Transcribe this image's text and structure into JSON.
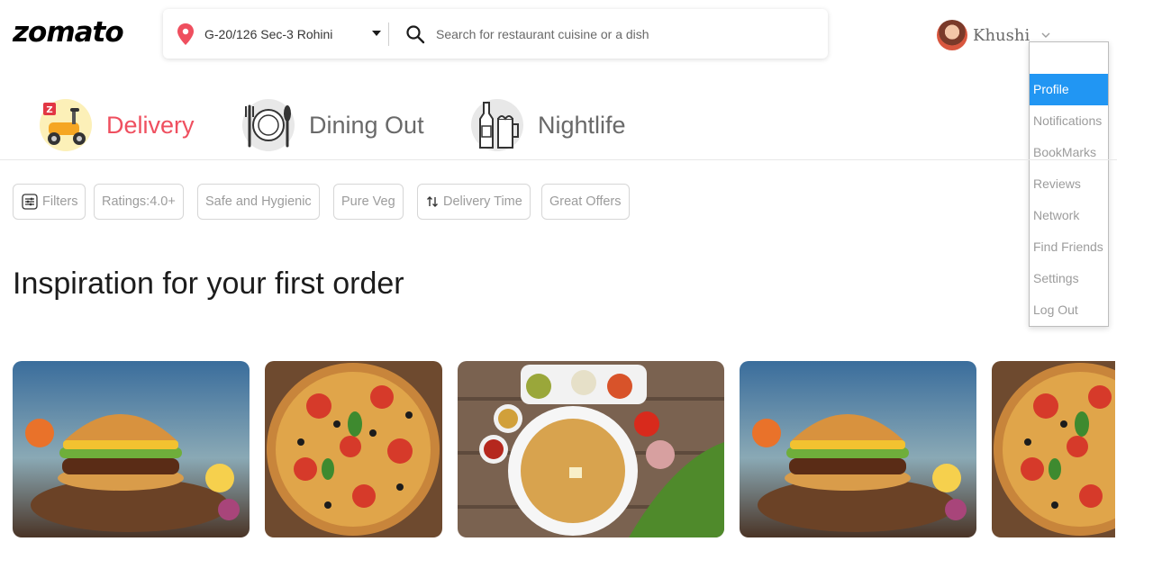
{
  "header": {
    "logo": "zomato",
    "location": "G-20/126 Sec-3 Rohini",
    "search_placeholder": "Search for restaurant cuisine or a dish",
    "user_name": "Khushi"
  },
  "user_menu": {
    "items": [
      "Profile",
      "Notifications",
      "BookMarks",
      "Reviews",
      "Network",
      "Find Friends",
      "Settings",
      "Log Out"
    ],
    "active": "Profile"
  },
  "tabs": [
    {
      "label": "Delivery",
      "icon": "scooter-icon",
      "active": true
    },
    {
      "label": "Dining Out",
      "icon": "dining-plate-icon",
      "active": false
    },
    {
      "label": "Nightlife",
      "icon": "bottle-glass-icon",
      "active": false
    }
  ],
  "filters": [
    "Filters",
    "Ratings:4.0+",
    "Safe and Hygienic",
    "Pure Veg",
    "Delivery Time",
    "Great Offers"
  ],
  "section_title": "Inspiration for your first order",
  "cards": [
    {
      "icon": "burger-image"
    },
    {
      "icon": "pizza-image"
    },
    {
      "icon": "paratha-thali-image"
    },
    {
      "icon": "burger-image"
    },
    {
      "icon": "pizza-image"
    }
  ],
  "colors": {
    "brand_red": "#ef4f5f",
    "menu_active": "#2196f3",
    "muted_text": "#9c9c9c",
    "tab_text": "#696969"
  }
}
